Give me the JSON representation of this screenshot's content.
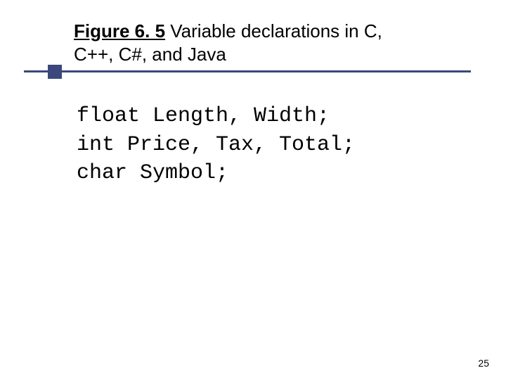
{
  "title": {
    "figure_label": "Figure 6. 5",
    "rest_line1": "   Variable declarations in C,",
    "line2": "C++, C#, and Java"
  },
  "code": {
    "line1": "float Length, Width;",
    "line2": "int Price, Tax, Total;",
    "line3": "char Symbol;"
  },
  "page_number": "25"
}
